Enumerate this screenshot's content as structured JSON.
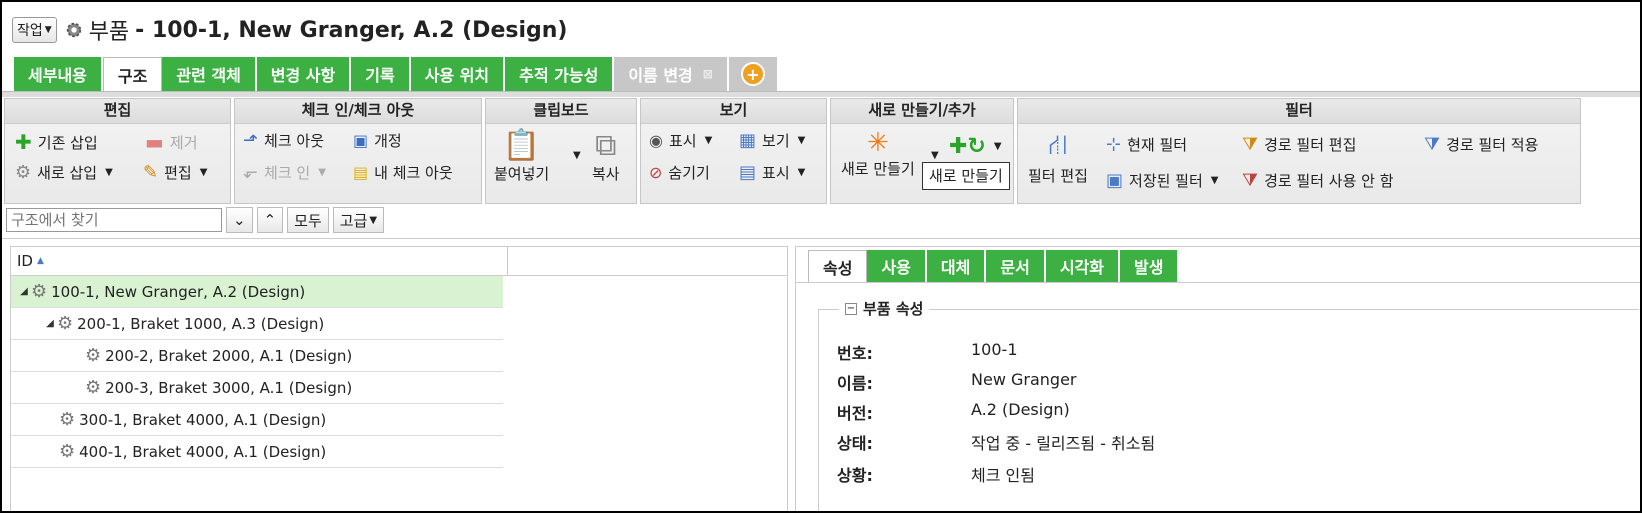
{
  "header": {
    "action_label": "작업",
    "title_prefix": "부품",
    "title_main": "- 100-1, New Granger, A.2 (Design)"
  },
  "tabs": [
    {
      "label": "세부내용"
    },
    {
      "label": "구조"
    },
    {
      "label": "관련 객체"
    },
    {
      "label": "변경 사항"
    },
    {
      "label": "기록"
    },
    {
      "label": "사용 위치"
    },
    {
      "label": "추적 가능성"
    },
    {
      "label": "이름 변경"
    }
  ],
  "ribbon": {
    "edit": {
      "title": "편집",
      "insert_existing": "기존 삽입",
      "remove": "제거",
      "insert_new": "새로 삽입",
      "edit": "편집"
    },
    "checkin": {
      "title": "체크 인/체크 아웃",
      "checkout": "체크 아웃",
      "revise": "개정",
      "checkin": "체크 인",
      "my_checkouts": "내 체크 아웃"
    },
    "clipboard": {
      "title": "클립보드",
      "paste": "붙여넣기",
      "copy": "복사"
    },
    "view": {
      "title": "보기",
      "show": "표시",
      "view": "보기",
      "hide": "숨기기",
      "display": "표시"
    },
    "new": {
      "title": "새로 만들기/추가",
      "new": "새로 만들기",
      "tooltip": "새로 만들기"
    },
    "filter": {
      "title": "필터",
      "edit_filter": "필터 편집",
      "current_filter": "현재 필터",
      "saved_filter": "저장된 필터",
      "edit_path_filter": "경로 필터 편집",
      "disable_path_filter": "경로 필터 사용 안 함",
      "apply_path_filter": "경로 필터 적용"
    }
  },
  "search": {
    "placeholder": "구조에서 찾기",
    "all": "모두",
    "advanced": "고급"
  },
  "tree": {
    "header": "ID",
    "rows": [
      {
        "label": "100-1, New Granger, A.2 (Design)"
      },
      {
        "label": "200-1, Braket 1000, A.3 (Design)"
      },
      {
        "label": "200-2, Braket 2000, A.1 (Design)"
      },
      {
        "label": "200-3, Braket 3000, A.1 (Design)"
      },
      {
        "label": "300-1, Braket 4000, A.1 (Design)"
      },
      {
        "label": "400-1, Braket 4000, A.1 (Design)"
      }
    ]
  },
  "details": {
    "tabs": [
      "속성",
      "사용",
      "대체",
      "문서",
      "시각화",
      "발생"
    ],
    "section_title": "부품 속성",
    "fields": [
      {
        "label": "번호:",
        "value": "100-1"
      },
      {
        "label": "이름:",
        "value": "New Granger"
      },
      {
        "label": "버전:",
        "value": "A.2 (Design)"
      },
      {
        "label": "상태:",
        "value": "작업 중 - 릴리즈됨 - 취소됨"
      },
      {
        "label": "상황:",
        "value": "체크 인됨"
      }
    ]
  },
  "colors": {
    "tab_green": "#3cb043",
    "selected_row": "#d9f2d2",
    "disabled_tab": "#c7c7c7"
  }
}
